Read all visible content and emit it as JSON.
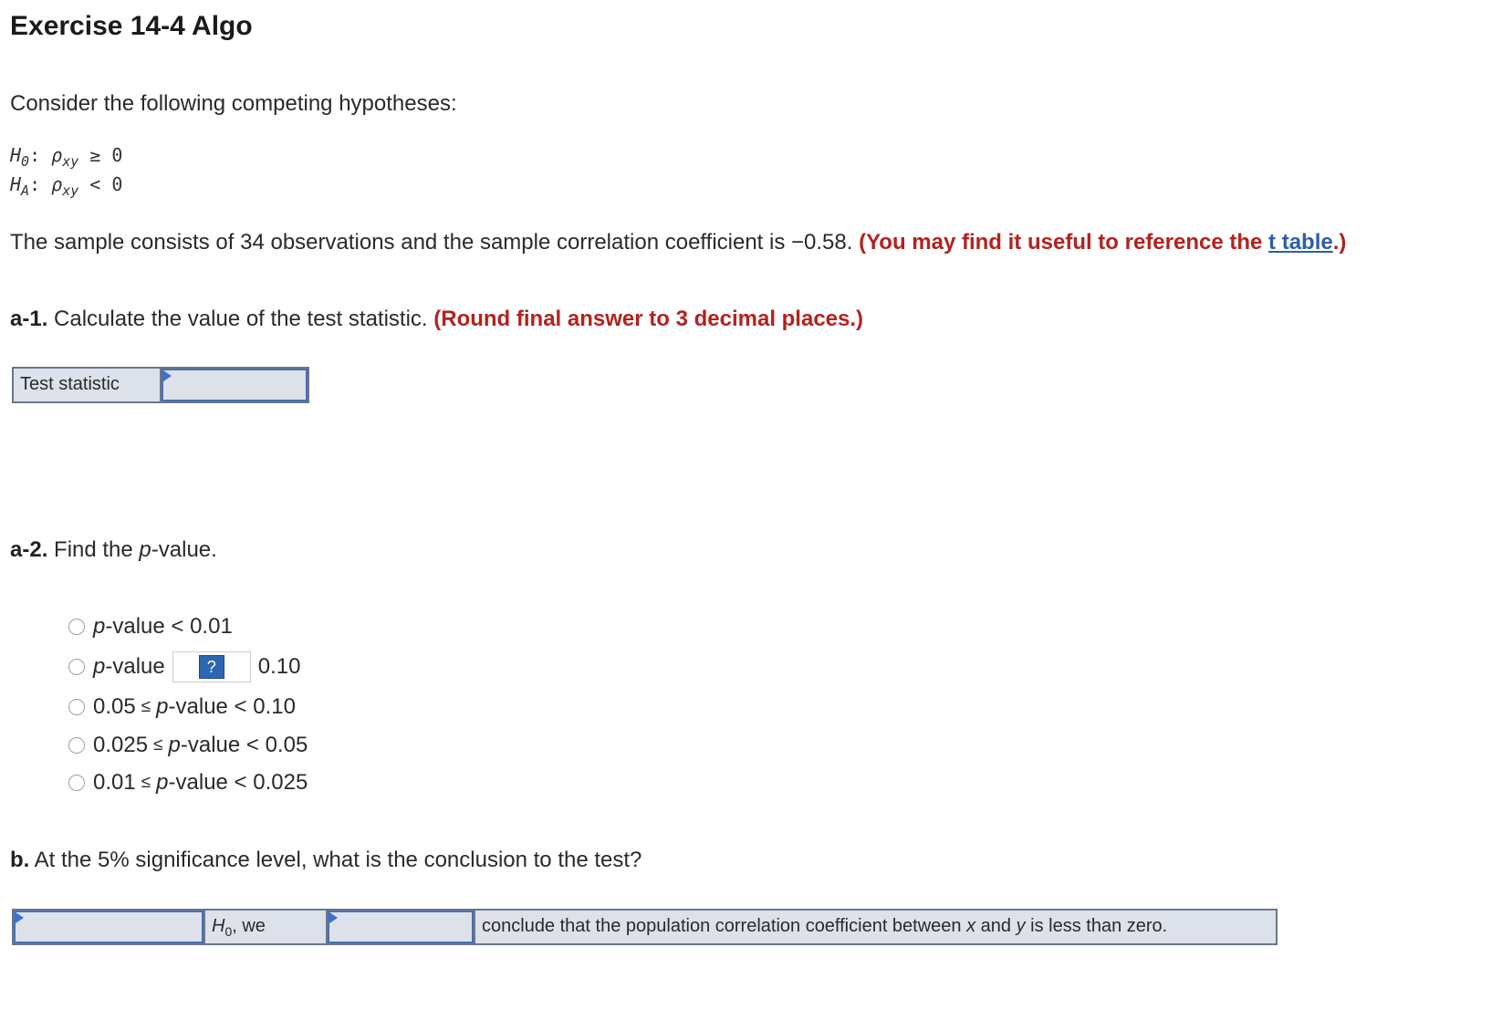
{
  "title": "Exercise 14-4 Algo",
  "intro": "Consider the following competing hypotheses:",
  "hypotheses": {
    "h0": {
      "symbol": "H",
      "subscript": "0",
      "rho": "ρ",
      "rho_sub": "xy",
      "relation": "≥ 0"
    },
    "ha": {
      "symbol": "H",
      "subscript": "A",
      "rho": "ρ",
      "rho_sub": "xy",
      "relation": "< 0"
    }
  },
  "problem": {
    "text": "The sample consists of 34 observations and the sample correlation coefficient is −0.58.",
    "hint_prefix": "(You may find it useful to reference the",
    "hint_link": "t table",
    "hint_suffix": ".)"
  },
  "a1": {
    "label": "a-1.",
    "text": "Calculate the value of the test statistic.",
    "instruction": "(Round final answer to 3 decimal places.)",
    "row_label": "Test statistic",
    "answer": ""
  },
  "a2": {
    "label": "a-2.",
    "text_before": "Find the",
    "text_p": "p",
    "text_after": "-value.",
    "options": [
      {
        "pre": "",
        "p": "p",
        "post": "-value < 0.01"
      },
      {
        "pre": "",
        "p": "p",
        "post": "-value",
        "dropdown": "?",
        "after": "0.10"
      },
      {
        "pre": "0.05",
        "le": "≤",
        "p": "p",
        "post": "-value < 0.10"
      },
      {
        "pre": "0.025",
        "le": "≤",
        "p": "p",
        "post": "-value < 0.05"
      },
      {
        "pre": "0.01",
        "le": "≤",
        "p": "p",
        "post": "-value < 0.025"
      }
    ]
  },
  "b": {
    "label": "b.",
    "text": "At the 5% significance level, what is the conclusion to the test?",
    "h0": "H",
    "h0_sub": "0",
    "h0_after": ", we",
    "conclusion_1": "conclude that the population correlation coefficient between",
    "x": "x",
    "and": "and",
    "y": "y",
    "conclusion_2": "is less than zero."
  }
}
